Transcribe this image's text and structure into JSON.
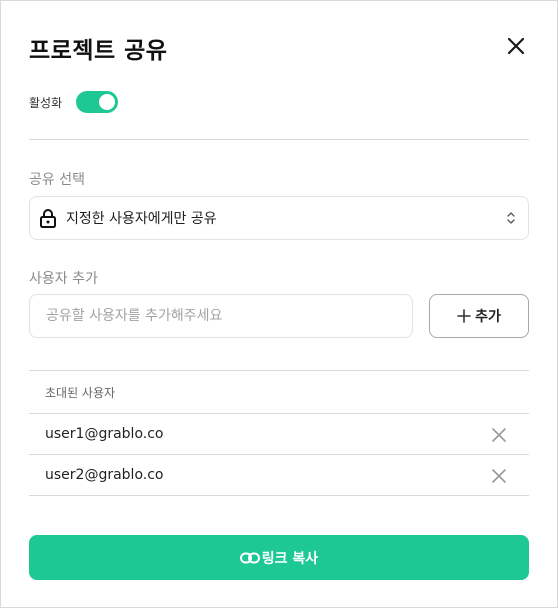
{
  "dialog": {
    "title": "프로젝트 공유",
    "close_icon": "close-icon"
  },
  "activation": {
    "label": "활성화",
    "enabled": true,
    "accent_color": "#1ec895"
  },
  "share_select": {
    "section_label": "공유 선택",
    "selected_value": "지정한 사용자에게만 공유",
    "icon": "lock-icon",
    "caret_icon": "chevron-up-down-icon"
  },
  "add_user": {
    "section_label": "사용자 추가",
    "placeholder": "공유할 사용자를 추가해주세요",
    "value": "",
    "button_label": "추가",
    "button_icon": "plus-icon"
  },
  "invited": {
    "header": "초대된 사용자",
    "users": [
      {
        "email": "user1@grablo.co"
      },
      {
        "email": "user2@grablo.co"
      }
    ],
    "remove_icon": "close-icon"
  },
  "copy_link": {
    "label": "링크 복사",
    "icon": "link-icon"
  }
}
